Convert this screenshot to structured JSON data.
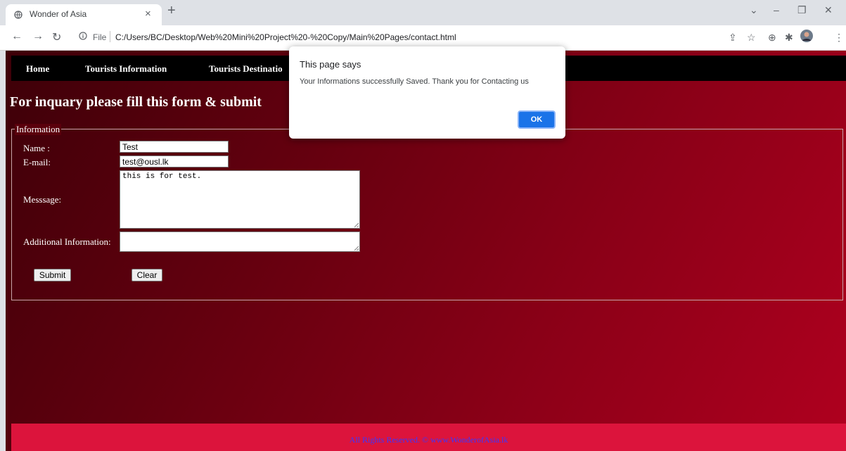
{
  "browser": {
    "tab_title": "Wonder of Asia",
    "tab_close": "×",
    "new_tab": "+",
    "address_label": "File",
    "url": "C:/Users/BC/Desktop/Web%20Mini%20Project%20-%20Copy/Main%20Pages/contact.html",
    "window_minimize": "–",
    "window_restore": "❐",
    "window_close": "✕",
    "tab_search": "⌄"
  },
  "nav": {
    "items": [
      {
        "label": "Home"
      },
      {
        "label": "Tourists Information"
      },
      {
        "label": "Tourists Destinatio"
      }
    ]
  },
  "page": {
    "heading": "For inquary please fill this form & submit",
    "fieldset_legend": "Information"
  },
  "form": {
    "name_label": "Name :",
    "name_value": "Test",
    "email_label": "E-mail:",
    "email_value": "test@ousl.lk",
    "message_label": "Messsage:",
    "message_value": "this is for test.",
    "additional_label": "Additional Information:",
    "additional_value": "",
    "submit_label": "Submit",
    "clear_label": "Clear"
  },
  "footer": {
    "text": "All Rights Reserved. © www.WonderofAsia.lk"
  },
  "dialog": {
    "title": "This page says",
    "message": "Your Informations successfully Saved. Thank you for Contacting us",
    "ok_label": "OK"
  },
  "colors": {
    "page_gradient_dark": "#3d0008",
    "page_gradient_light": "#b0001f",
    "nav_bg": "#000000",
    "footer_bg": "#dc143c",
    "footer_text": "#3b36ff",
    "dialog_ok": "#1a73e8"
  }
}
